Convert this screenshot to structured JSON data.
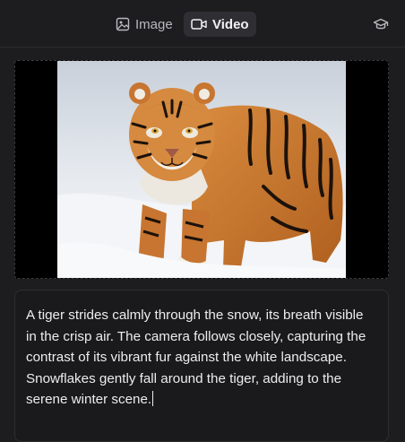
{
  "tabs": {
    "image_label": "Image",
    "video_label": "Video",
    "active": "video"
  },
  "icons": {
    "image_tab": "image-icon",
    "video_tab": "video-camera-icon",
    "top_right": "graduation-cap-icon"
  },
  "prompt": {
    "text": "A tiger strides calmly through the snow, its breath visible in the crisp air. The camera follows closely, capturing the contrast of its vibrant fur against the white landscape. Snowflakes gently fall around the tiger, adding to the serene winter scene."
  },
  "colors": {
    "background": "#1d1d1f",
    "active_tab": "#2f2f33",
    "text": "#ededf0"
  }
}
